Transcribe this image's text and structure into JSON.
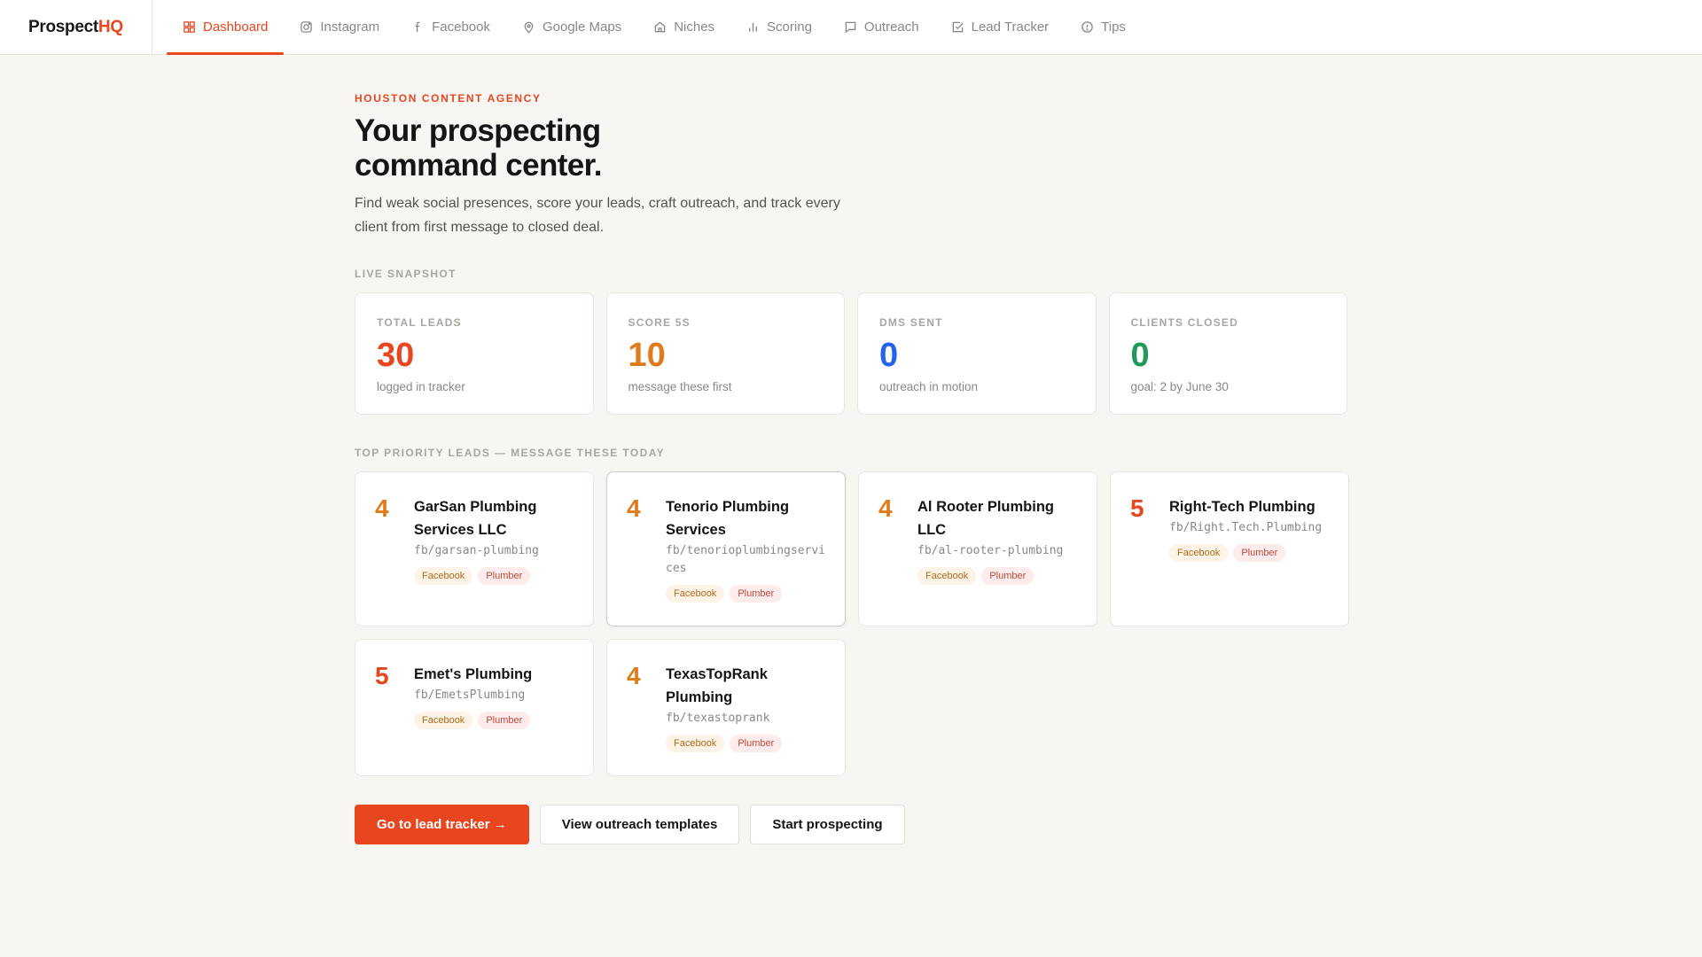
{
  "brand": {
    "name_a": "Prospect",
    "name_b": "HQ"
  },
  "nav": [
    {
      "label": "Dashboard",
      "icon": "grid-icon",
      "active": true
    },
    {
      "label": "Instagram",
      "icon": "instagram-icon"
    },
    {
      "label": "Facebook",
      "icon": "facebook-icon"
    },
    {
      "label": "Google Maps",
      "icon": "map-pin-icon"
    },
    {
      "label": "Niches",
      "icon": "home-icon"
    },
    {
      "label": "Scoring",
      "icon": "bar-chart-icon"
    },
    {
      "label": "Outreach",
      "icon": "message-icon"
    },
    {
      "label": "Lead Tracker",
      "icon": "checkbox-icon"
    },
    {
      "label": "Tips",
      "icon": "info-icon"
    }
  ],
  "hero": {
    "eyebrow": "HOUSTON CONTENT AGENCY",
    "title": "Your prospecting command center.",
    "lede": "Find weak social presences, score your leads, craft outreach, and track every client from first message to closed deal."
  },
  "snapshot": {
    "label": "LIVE SNAPSHOT",
    "stats": [
      {
        "label": "TOTAL LEADS",
        "value": "30",
        "sub": "logged in tracker",
        "color": "#e8461e"
      },
      {
        "label": "SCORE 5S",
        "value": "10",
        "sub": "message these first",
        "color": "#e07b1a"
      },
      {
        "label": "DMS SENT",
        "value": "0",
        "sub": "outreach in motion",
        "color": "#2463eb"
      },
      {
        "label": "CLIENTS CLOSED",
        "value": "0",
        "sub": "goal: 2 by June 30",
        "color": "#1f9a5a"
      }
    ]
  },
  "priority": {
    "label": "TOP PRIORITY LEADS — MESSAGE THESE TODAY",
    "leads": [
      {
        "score": "4",
        "name": "GarSan Plumbing Services LLC",
        "handle": "fb/garsan-plumbing",
        "tags": [
          "Facebook",
          "Plumber"
        ]
      },
      {
        "score": "4",
        "name": "Tenorio Plumbing Services",
        "handle": "fb/tenorioplumbingservices",
        "tags": [
          "Facebook",
          "Plumber"
        ]
      },
      {
        "score": "4",
        "name": "Al Rooter Plumbing LLC",
        "handle": "fb/al-rooter-plumbing",
        "tags": [
          "Facebook",
          "Plumber"
        ]
      },
      {
        "score": "5",
        "name": "Right-Tech Plumbing",
        "handle": "fb/Right.Tech.Plumbing",
        "tags": [
          "Facebook",
          "Plumber"
        ]
      },
      {
        "score": "5",
        "name": "Emet's Plumbing",
        "handle": "fb/EmetsPlumbing",
        "tags": [
          "Facebook",
          "Plumber"
        ]
      },
      {
        "score": "4",
        "name": "TexasTopRank Plumbing",
        "handle": "fb/texastoprank",
        "tags": [
          "Facebook",
          "Plumber"
        ]
      }
    ],
    "score_colors": {
      "4": "#e07b1a",
      "5": "#e8461e"
    }
  },
  "actions": {
    "primary": "Go to lead tracker →",
    "templates": "View outreach templates",
    "start": "Start prospecting"
  }
}
